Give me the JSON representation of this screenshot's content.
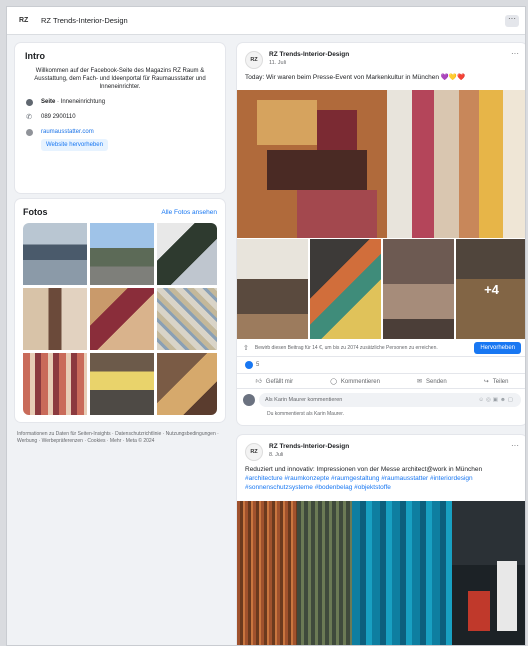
{
  "page": {
    "name": "RZ Trends-Interior-Design",
    "logo_text": "RZ"
  },
  "icons": {
    "more": "more-dots-icon",
    "category": "info-dot-icon",
    "phone": "phone-icon",
    "web": "globe-icon",
    "like": "thumb-up-icon",
    "comment": "comment-bubble-icon",
    "send": "send-icon",
    "share": "share-arrow-icon"
  },
  "colors": {
    "brand_blue": "#1877f2",
    "page_bg": "#f0f2f5",
    "card_bg": "#ffffff"
  },
  "intro": {
    "heading": "Intro",
    "bio": "Willkommen auf der Facebook-Seite des Magazins RZ Raum & Ausstattung, dem Fach- und Ideenportal für Raumausstatter und Inneneinrichter.",
    "category_label": "Seite",
    "category_value": " · Inneneinrichtung",
    "phone": "089 2900110",
    "website": "raumausstatter.com",
    "promote_website": "Website hervorheben"
  },
  "photos": {
    "heading": "Fotos",
    "see_all": "Alle Fotos ansehen"
  },
  "footer": {
    "text": "Informationen zu Daten für Seiten-Insights · Datenschutzrichtlinie · Nutzungsbedingungen · Werbung · Werbepräferenzen · Cookies · Mehr · Meta © 2024"
  },
  "posts": [
    {
      "author": "RZ Trends-Interior-Design",
      "date": "11. Juli",
      "text": "Today: Wir waren beim Presse-Event von  Markenkultur in München 💜💛❤️",
      "extra_count": "+4",
      "boost_text": "Bewirb diesen Beitrag für 14 €, um bis zu 2074 zusätzliche Personen zu erreichen.",
      "boost_button": "Hervorheben",
      "reactions_count": "5",
      "actions": {
        "like": "Gefällt mir",
        "comment": "Kommentieren",
        "send": "Senden",
        "share": "Teilen"
      },
      "comment_placeholder": "Als Karin Maurer kommentieren",
      "comment_note": "Du kommentierst als Karin Maurer."
    },
    {
      "author": "RZ Trends-Interior-Design",
      "date": "8. Juli",
      "text": "Reduziert und innovativ: Impressionen von der Messe architect@work in München",
      "hashtags": "#architecture #raumkonzepte #raumgestaltung #raumausstatter #interiordesign #sonnenschutzsysteme #bodenbelag #objektstoffe"
    }
  ]
}
